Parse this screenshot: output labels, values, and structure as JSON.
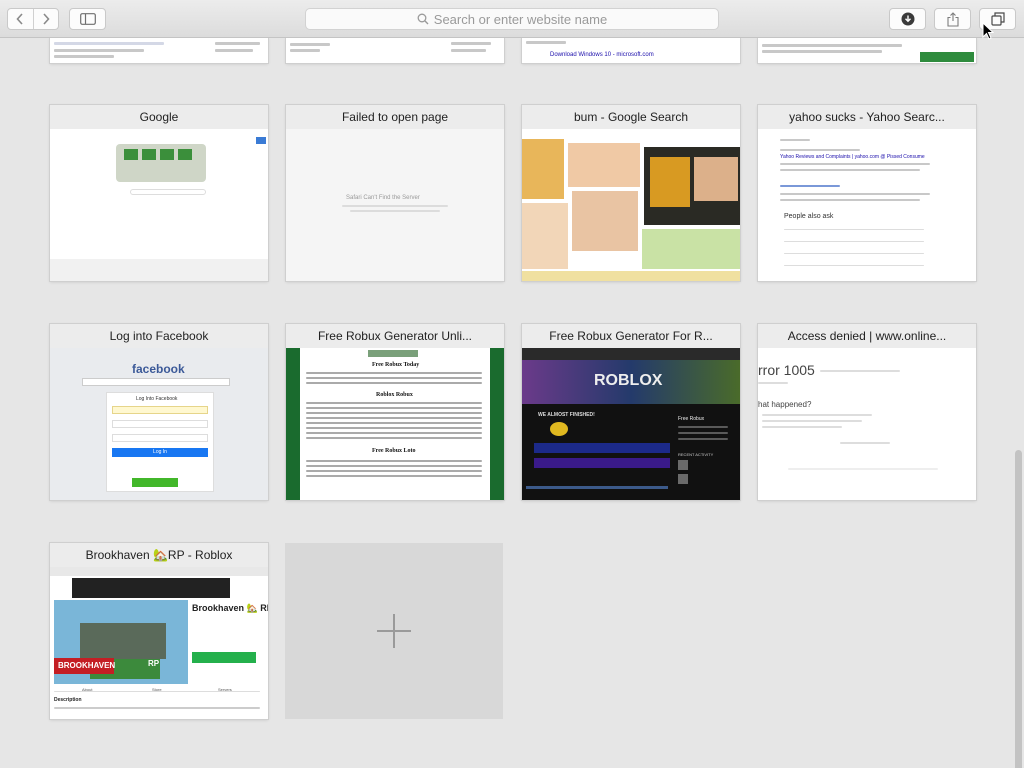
{
  "toolbar": {
    "address_placeholder": "Search or enter website name"
  },
  "partial_row": [
    {
      "snippet": ""
    },
    {
      "snippet": ""
    },
    {
      "snippet": "Download Windows 10 - microsoft.com"
    },
    {
      "snippet": ""
    }
  ],
  "tabs": [
    {
      "title": "Google"
    },
    {
      "title": "Failed to open page",
      "body_heading": "Safari Can't Find the Server"
    },
    {
      "title": "bum - Google Search"
    },
    {
      "title": "yahoo sucks - Yahoo Searc...",
      "result_link": "Yahoo Reviews and Complaints | yahoo.com @ Pissed Consume",
      "people_also_ask": "People also ask"
    },
    {
      "title": "Log into Facebook",
      "logo": "facebook",
      "login_heading": "Log Into Facebook",
      "login_button": "Log In"
    },
    {
      "title": "Free Robux Generator Unli...",
      "heading1": "Free Robux Today",
      "heading2": "Roblox Robux",
      "heading3": "Free Robux Loto"
    },
    {
      "title": "Free Robux Generator For R...",
      "logo": "ROBLOX",
      "banner": "WE ALMOST FINISHED!",
      "side_heading": "Free Robux",
      "recent": "RECENT ACTIVITY"
    },
    {
      "title": "Access denied | www.online...",
      "error": "rror 1005",
      "question": "hat happened?"
    },
    {
      "title": "Brookhaven 🏡RP - Roblox",
      "game_name": "Brookhaven 🏡 RP",
      "badge": "BROOKHAVEN",
      "rp": "RP",
      "tab_about": "About",
      "tab_store": "Store",
      "tab_servers": "Servers",
      "description": "Description"
    }
  ],
  "new_tab_symbol": "+"
}
